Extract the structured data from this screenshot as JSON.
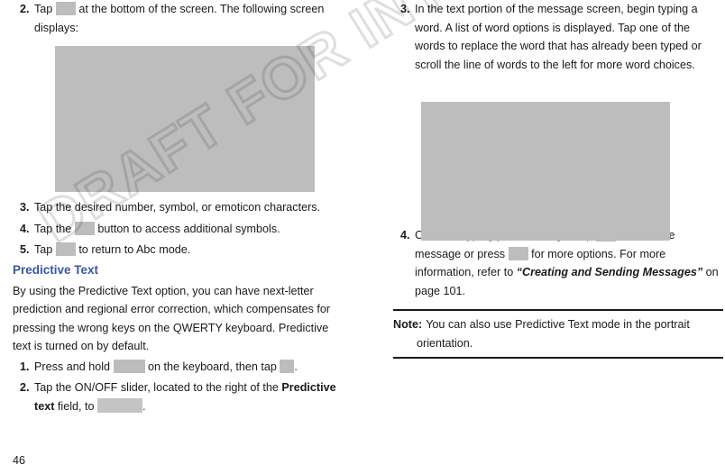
{
  "document": {
    "page_number": "46",
    "watermark": "DRAFT FOR INTERNAL USE ONLY",
    "heading_color": "#3b55a5",
    "placeholder_color": "#bdbdbd"
  },
  "left_column": {
    "steps": [
      {
        "number": "2.",
        "text_before": "Tap",
        "text_after": "at the bottom of the screen. The following screen displays:",
        "icon": "symbols-key-chip"
      },
      {
        "number": "3.",
        "text": "Tap the desired number, symbol, or emoticon characters."
      },
      {
        "number": "4.",
        "text_before": "Tap the",
        "text_after": "button to access additional symbols.",
        "icon": "more-symbols-key-chip"
      },
      {
        "number": "5.",
        "text_before": "Tap",
        "text_after": "to return to Abc mode.",
        "icon": "abc-key-chip"
      }
    ],
    "figure_caption": "symbols-keyboard-screenshot",
    "section_heading": "Predictive Text",
    "paragraph": "By using the Predictive Text option, you can have next-letter prediction and regional error correction, which compensates for pressing the wrong keys on the QWERTY keyboard. Predictive text is turned on by default.",
    "predictive_steps": [
      {
        "number": "1.",
        "text_before": "Press and hold",
        "text_middle": "on the keyboard, then tap",
        "text_after": ".",
        "icon_1": "settings-key-chip",
        "icon_2": "settings-gear-chip"
      },
      {
        "number": "2.",
        "text_before": "Tap the ON/OFF slider, located to the right of the",
        "bold_text": "Predictive text",
        "text_middle": "field, to",
        "text_after": ".",
        "icon": "on-off-slider-graphic"
      }
    ]
  },
  "right_column": {
    "steps": [
      {
        "number": "3.",
        "text": "In the text portion of the message screen, begin typing a word. A list of word options is displayed. Tap one of the words to replace the word that has already been typed or scroll the line of words to the left for more word choices."
      },
      {
        "number": "4.",
        "text_before": "Continue typing your message. Tap",
        "text_middle": "to send the message or press",
        "text_middle_2": "for more options. For more information, refer to",
        "italic_ref": "“Creating and Sending Messages”",
        "text_after": "on page 101.",
        "icon_1": "send-key-chip",
        "icon_2": "menu-key-chip"
      }
    ],
    "figure_caption": "predictive-text-screenshot",
    "note": {
      "label": "Note:",
      "line_1": "You can also use Predictive Text mode in the portrait",
      "line_2": "orientation."
    }
  }
}
